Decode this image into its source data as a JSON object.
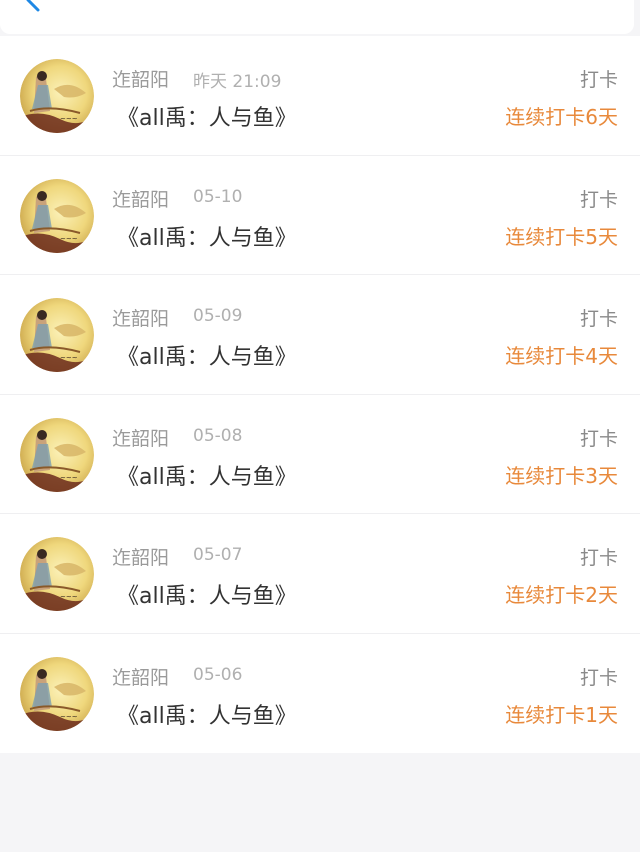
{
  "header": {
    "back_icon": "chevron-left-icon",
    "accent_color": "#1e88e5"
  },
  "records": [
    {
      "name": "迮韶阳",
      "time": "昨天 21:09",
      "title": "《all禹：人与鱼》",
      "tag": "打卡",
      "streak": "连续打卡6天"
    },
    {
      "name": "迮韶阳",
      "time": "05-10",
      "title": "《all禹：人与鱼》",
      "tag": "打卡",
      "streak": "连续打卡5天"
    },
    {
      "name": "迮韶阳",
      "time": "05-09",
      "title": "《all禹：人与鱼》",
      "tag": "打卡",
      "streak": "连续打卡4天"
    },
    {
      "name": "迮韶阳",
      "time": "05-08",
      "title": "《all禹：人与鱼》",
      "tag": "打卡",
      "streak": "连续打卡3天"
    },
    {
      "name": "迮韶阳",
      "time": "05-07",
      "title": "《all禹：人与鱼》",
      "tag": "打卡",
      "streak": "连续打卡2天"
    },
    {
      "name": "迮韶阳",
      "time": "05-06",
      "title": "《all禹：人与鱼》",
      "tag": "打卡",
      "streak": "连续打卡1天"
    }
  ],
  "colors": {
    "streak": "#e8893b",
    "name": "#9a9a9a",
    "time": "#b0b0b0",
    "title": "#333333"
  }
}
